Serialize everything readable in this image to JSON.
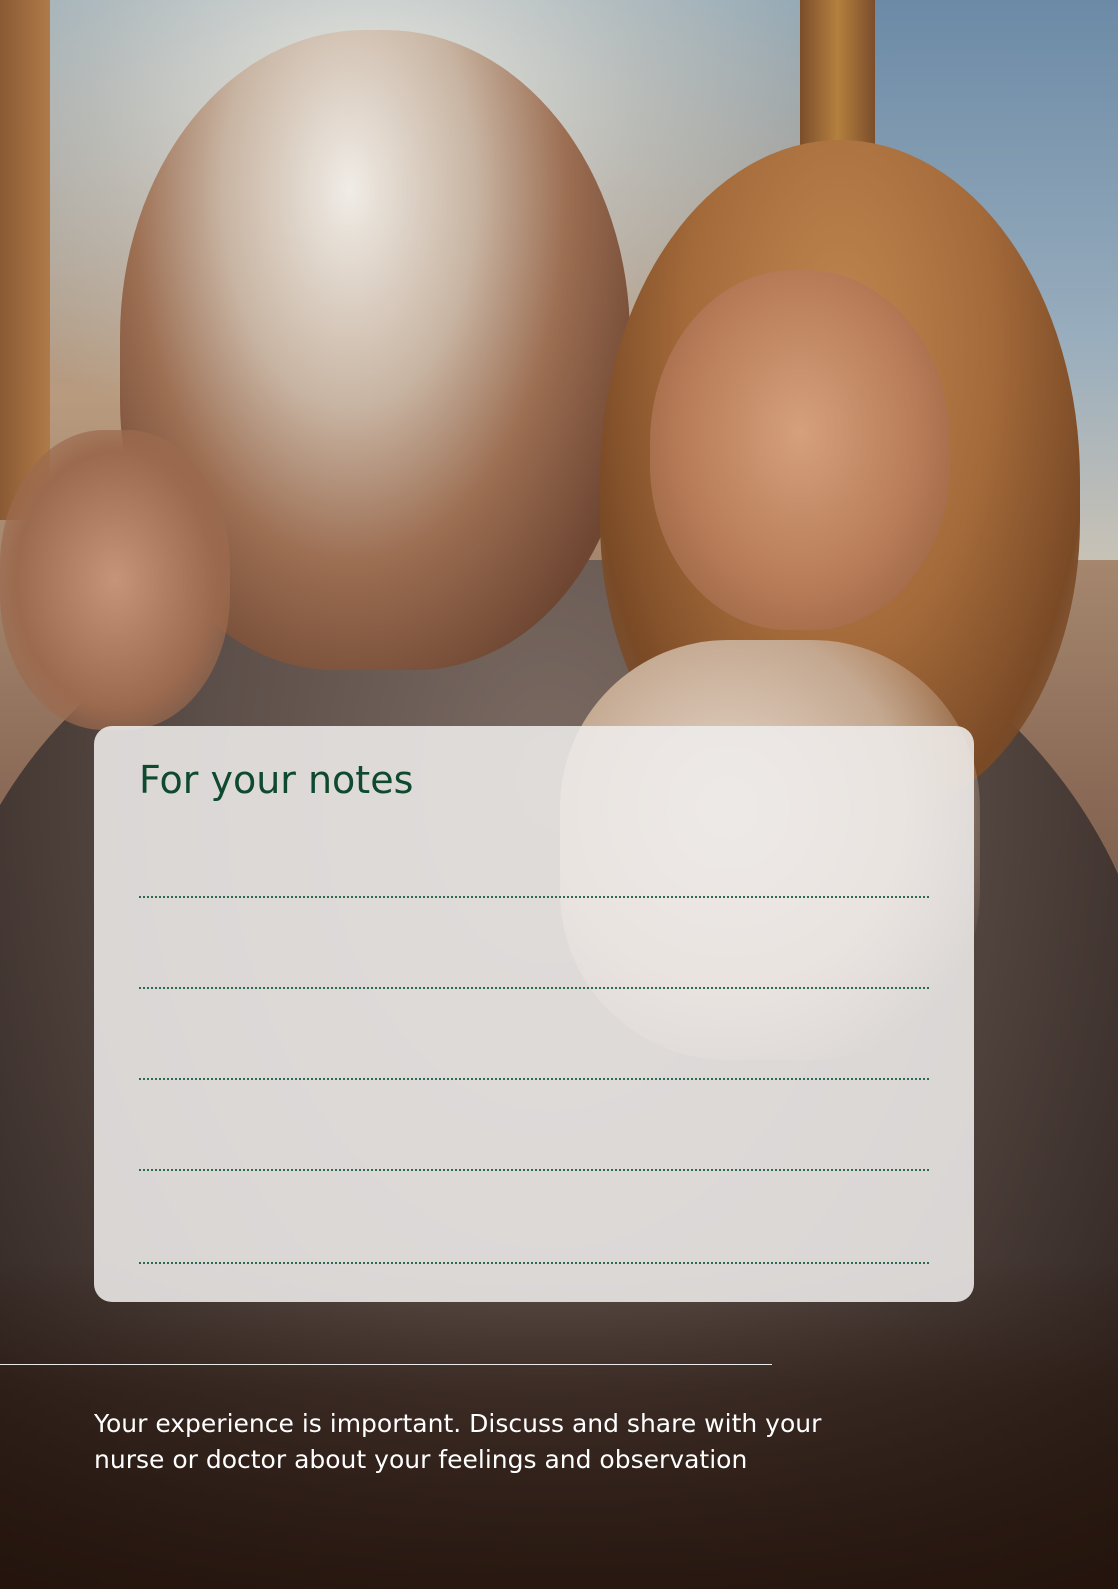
{
  "notes": {
    "title": "For your notes",
    "line_count": 5
  },
  "footer": {
    "message": "Your experience is important. Discuss and share with your nurse or doctor about your feelings and observation"
  },
  "colors": {
    "title_green": "#0f4a2e",
    "dotted_line_green": "#2e6a4c",
    "card_background": "#eeecea",
    "footer_text": "#ffffff"
  }
}
